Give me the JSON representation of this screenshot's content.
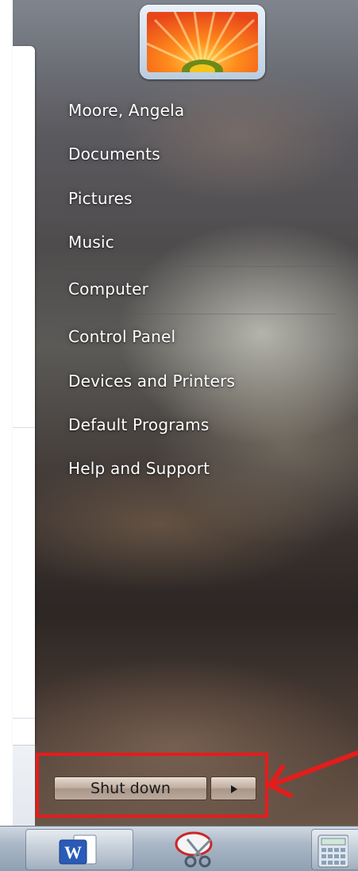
{
  "user_panel": {
    "avatar_icon": "flower-user-picture",
    "links": [
      {
        "label": "Moore, Angela"
      },
      {
        "label": "Documents"
      },
      {
        "label": "Pictures"
      },
      {
        "label": "Music"
      },
      {
        "label": "Computer"
      },
      {
        "label": "Control Panel"
      },
      {
        "label": "Devices and Printers"
      },
      {
        "label": "Default Programs"
      },
      {
        "label": "Help and Support"
      }
    ]
  },
  "power": {
    "shut_down_label": "Shut down",
    "arrow_icon": "triangle-right-icon"
  },
  "taskbar": {
    "items": [
      {
        "icon": "word-icon",
        "label": "W"
      },
      {
        "icon": "snipping-tool-icon"
      },
      {
        "icon": "calculator-icon"
      }
    ]
  },
  "annotation": {
    "color": "#e41c1c"
  }
}
